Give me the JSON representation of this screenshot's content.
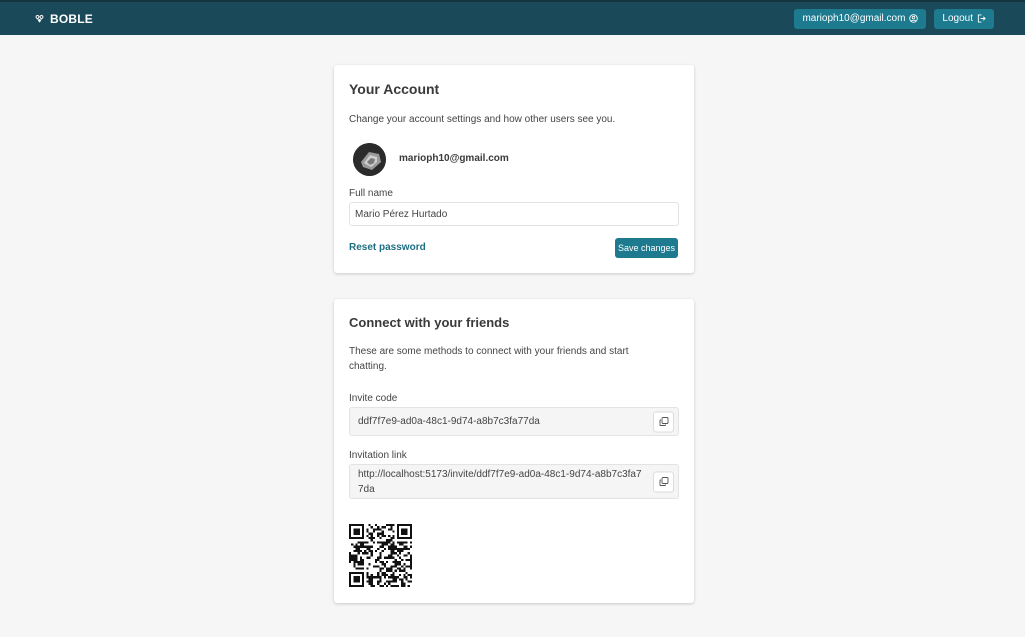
{
  "header": {
    "brand": "BOBLE",
    "user_email": "marioph10@gmail.com",
    "logout_label": "Logout"
  },
  "account": {
    "title": "Your Account",
    "description": "Change your account settings and how other users see you.",
    "email": "marioph10@gmail.com",
    "full_name_label": "Full name",
    "full_name_value": "Mario Pérez Hurtado",
    "reset_password_label": "Reset password",
    "save_label": "Save changes"
  },
  "connect": {
    "title": "Connect with your friends",
    "description": "These are some methods to connect with your friends and start chatting.",
    "invite_code_label": "Invite code",
    "invite_code_value": "ddf7f7e9-ad0a-48c1-9d74-a8b7c3fa77da",
    "invitation_link_label": "Invitation link",
    "invitation_link_value": "http://localhost:5173/invite/ddf7f7e9-ad0a-48c1-9d74-a8b7c3fa77da"
  },
  "colors": {
    "header_bg": "#1a4a5a",
    "accent": "#1d7a8f",
    "link": "#1d6e83",
    "page_bg": "#f6f6f6"
  },
  "icons": {
    "brand": "hearts-icon",
    "user": "user-circle-icon",
    "logout": "logout-icon",
    "copy": "copy-icon"
  }
}
